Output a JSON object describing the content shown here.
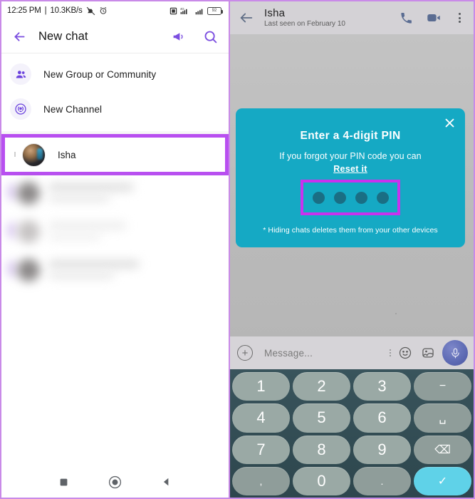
{
  "left_phone": {
    "status_bar": {
      "time": "12:25 PM",
      "separator": "|",
      "network_speed": "10.3KB/s",
      "icons": [
        "vpn-slash-icon",
        "alarm-icon",
        "sim-icon",
        "signal-4g-icon",
        "signal-icon",
        "battery-icon"
      ],
      "battery_level": "92"
    },
    "app_bar": {
      "back_label": "←",
      "title": "New chat",
      "actions": [
        {
          "name": "broadcast-icon",
          "label": "broadcast"
        },
        {
          "name": "search-icon",
          "label": "search"
        }
      ]
    },
    "menu_items": [
      {
        "icon": "new-group-icon",
        "label": "New Group or Community"
      },
      {
        "icon": "new-channel-icon",
        "label": "New Channel"
      }
    ],
    "highlighted_contact": {
      "section_letter": "I",
      "name": "Isha",
      "avatar": "contact-avatar",
      "highlight_color": "#b84ff0"
    },
    "blurred_rows": [
      {
        "id": "blurred-contact-1"
      },
      {
        "id": "blurred-contact-2"
      },
      {
        "id": "blurred-contact-3"
      }
    ],
    "nav_bar": [
      {
        "name": "recents-button",
        "glyph": "square"
      },
      {
        "name": "home-button",
        "glyph": "circle"
      },
      {
        "name": "back-button",
        "glyph": "triangle"
      }
    ]
  },
  "right_phone": {
    "app_bar": {
      "back_label": "←",
      "contact_name": "Isha",
      "status": "Last seen on February 10",
      "actions": [
        {
          "name": "voice-call-icon",
          "label": "call"
        },
        {
          "name": "video-call-icon",
          "label": "video call"
        },
        {
          "name": "overflow-menu-icon",
          "label": "more options"
        }
      ]
    },
    "pin_dialog": {
      "close_label": "✕",
      "title": "Enter a 4-digit PIN",
      "help_text": "If you forgot your PIN code you can",
      "reset_link": "Reset it",
      "pin_dots": 4,
      "footnote": "* Hiding chats deletes them from your other devices",
      "background_color": "#15a9c4",
      "dot_color": "#1a6e84",
      "highlight_color": "#c932ee"
    },
    "message_bar": {
      "attach_label": "+",
      "placeholder": "Message...",
      "icons": [
        "emoji-icon",
        "sticker-icon",
        "mic-icon"
      ]
    },
    "keypad": {
      "keys": [
        {
          "label": "1",
          "name": "key-1",
          "type": "digit"
        },
        {
          "label": "2",
          "name": "key-2",
          "type": "digit"
        },
        {
          "label": "3",
          "name": "key-3",
          "type": "digit"
        },
        {
          "label": "−",
          "name": "key-dash",
          "type": "symbol"
        },
        {
          "label": "4",
          "name": "key-4",
          "type": "digit"
        },
        {
          "label": "5",
          "name": "key-5",
          "type": "digit"
        },
        {
          "label": "6",
          "name": "key-6",
          "type": "digit"
        },
        {
          "label": "␣",
          "name": "key-space",
          "type": "symbol"
        },
        {
          "label": "7",
          "name": "key-7",
          "type": "digit"
        },
        {
          "label": "8",
          "name": "key-8",
          "type": "digit"
        },
        {
          "label": "9",
          "name": "key-9",
          "type": "digit"
        },
        {
          "label": "⌫",
          "name": "key-backspace",
          "type": "symbol"
        },
        {
          "label": ",",
          "name": "key-comma",
          "type": "symbol"
        },
        {
          "label": "0",
          "name": "key-0",
          "type": "digit"
        },
        {
          "label": ".",
          "name": "key-period",
          "type": "symbol"
        },
        {
          "label": "✓",
          "name": "key-enter",
          "type": "confirm"
        }
      ],
      "confirm_color": "#5fd2e8",
      "key_color": "#9aa9a5",
      "background_color": "#2d464d"
    }
  }
}
